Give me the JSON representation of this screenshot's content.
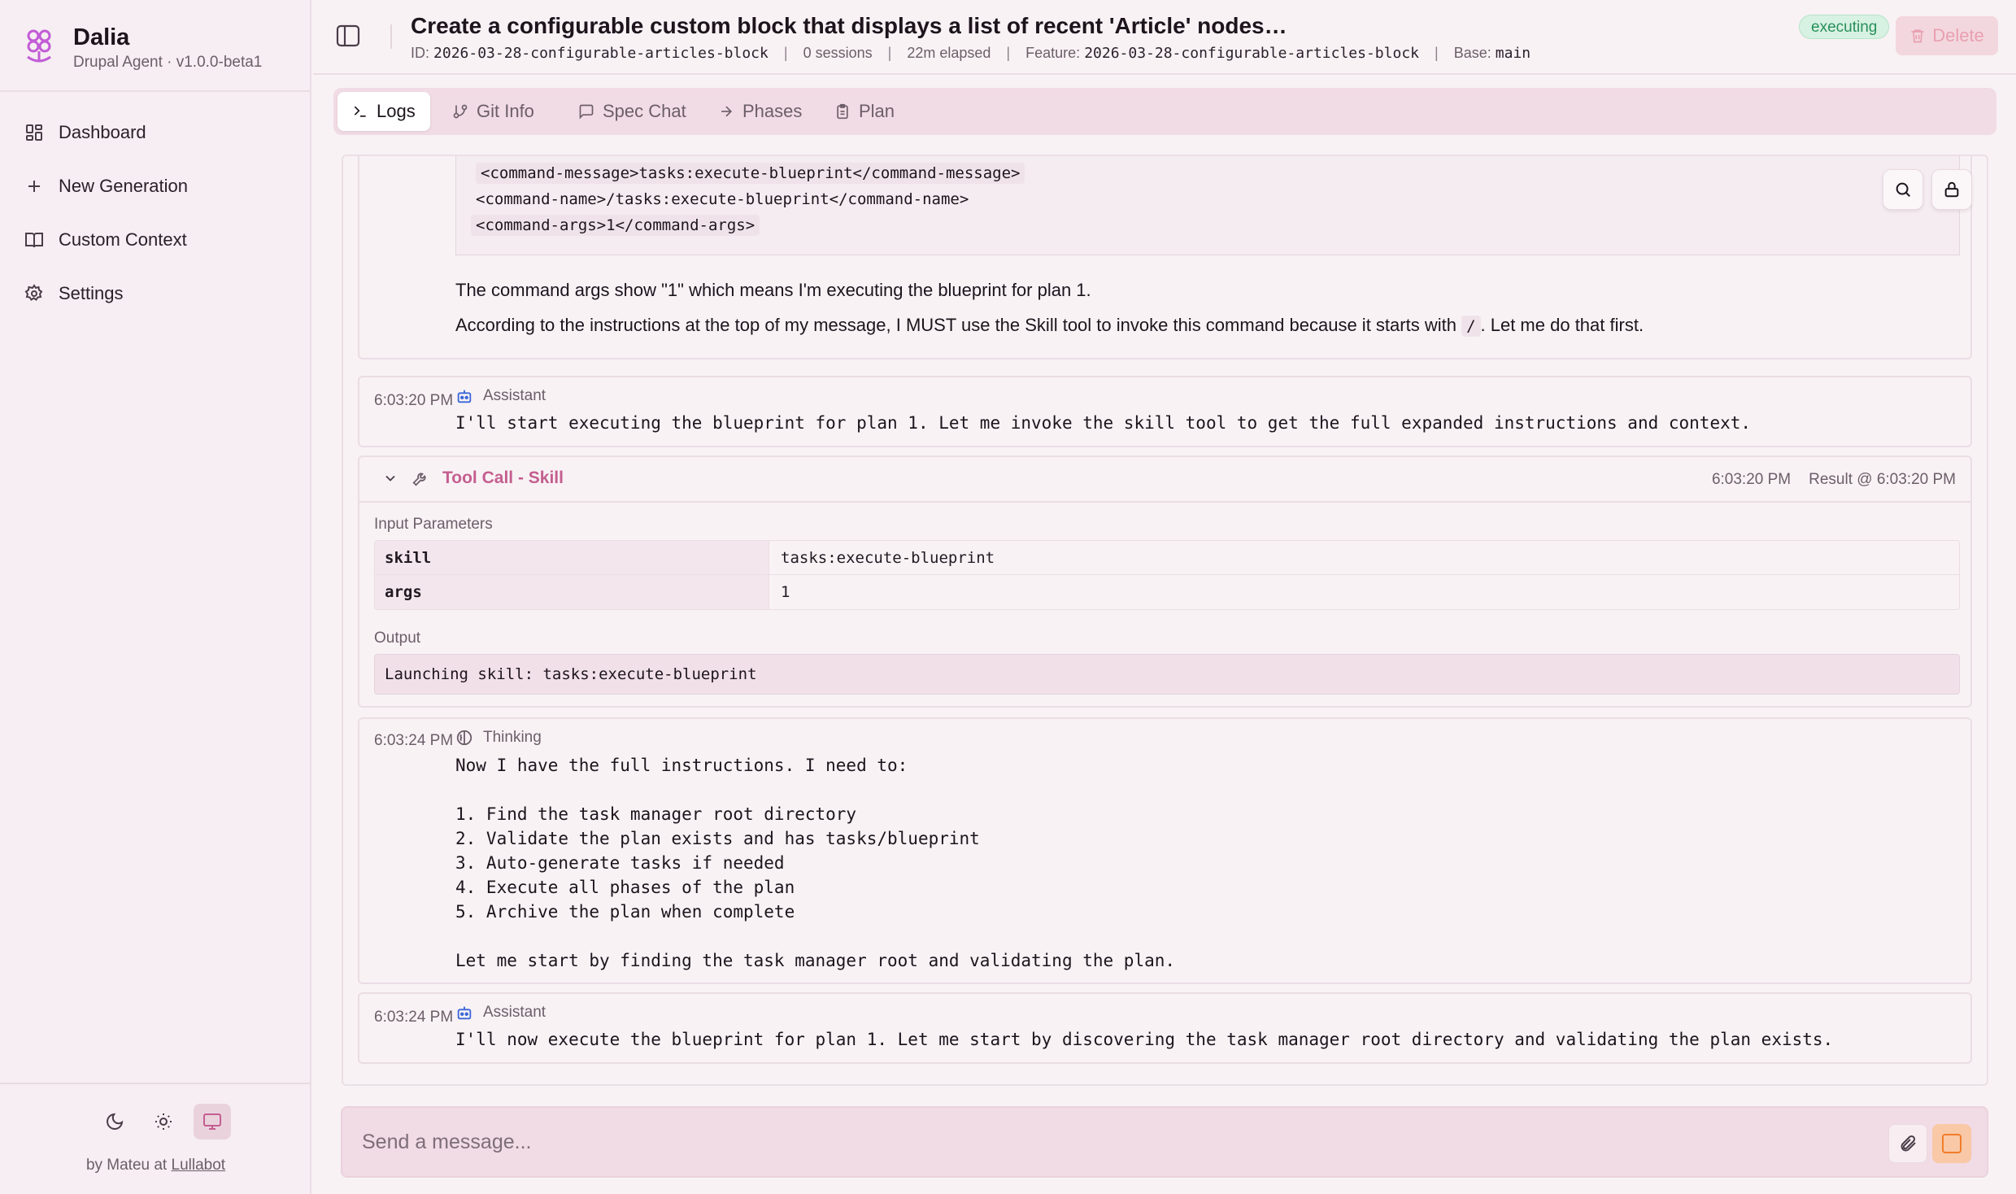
{
  "app": {
    "name": "Dalia",
    "subtitle": "Drupal Agent · v1.0.0-beta1",
    "credit_prefix": "by Mateu at",
    "credit_link": "Lullabot"
  },
  "sidebar": {
    "items": [
      {
        "label": "Dashboard",
        "icon": "dashboard-icon"
      },
      {
        "label": "New Generation",
        "icon": "plus-icon"
      },
      {
        "label": "Custom Context",
        "icon": "book-icon"
      },
      {
        "label": "Settings",
        "icon": "gear-icon"
      }
    ],
    "theme_options": [
      "dark",
      "light",
      "system"
    ],
    "theme_selected": "system"
  },
  "header": {
    "title": "Create a configurable custom block that displays a list of recent 'Article' nodes. Use dependency injection for the EntityType...",
    "status": "executing",
    "delete_label": "Delete",
    "meta": {
      "id_label": "ID:",
      "id_value": "2026-03-28-configurable-articles-block",
      "sessions": "0 sessions",
      "elapsed": "22m elapsed",
      "feature_label": "Feature:",
      "feature_value": "2026-03-28-configurable-articles-block",
      "base_label": "Base:",
      "base_value": "main"
    }
  },
  "tabs": [
    {
      "label": "Logs",
      "icon": "terminal-icon",
      "active": true
    },
    {
      "label": "Git Info",
      "icon": "git-branch-icon",
      "active": false
    },
    {
      "label": "Spec Chat",
      "icon": "chat-icon",
      "active": false
    },
    {
      "label": "Phases",
      "icon": "arrow-right-icon",
      "active": false
    },
    {
      "label": "Plan",
      "icon": "clipboard-icon",
      "active": false
    }
  ],
  "log": {
    "entry1": {
      "code_lines": [
        "<command-message>tasks:execute-blueprint</command-message>",
        "<command-name>/tasks:execute-blueprint</command-name>",
        "<command-args>1</command-args>"
      ],
      "para1": "The command args show \"1\" which means I'm executing the blueprint for plan 1.",
      "para2_before": "According to the instructions at the top of my message, I MUST use the Skill tool to invoke this command because it starts with",
      "para2_code": "/",
      "para2_after": ". Let me do that first."
    },
    "entry2": {
      "time": "6:03:20 PM",
      "role": "Assistant",
      "text": "I'll start executing the blueprint for plan 1. Let me invoke the skill tool to get the full expanded instructions and context."
    },
    "tool_call": {
      "title": "Tool Call - Skill",
      "time": "6:03:20 PM",
      "result": "Result @ 6:03:20 PM",
      "input_label": "Input Parameters",
      "params": [
        {
          "key": "skill",
          "value": "tasks:execute-blueprint"
        },
        {
          "key": "args",
          "value": "1"
        }
      ],
      "output_label": "Output",
      "output": "Launching skill: tasks:execute-blueprint"
    },
    "entry3": {
      "time": "6:03:24 PM",
      "role": "Thinking",
      "text": "Now I have the full instructions. I need to:\n\n1. Find the task manager root directory\n2. Validate the plan exists and has tasks/blueprint\n3. Auto-generate tasks if needed\n4. Execute all phases of the plan\n5. Archive the plan when complete\n\nLet me start by finding the task manager root and validating the plan."
    },
    "entry4": {
      "time": "6:03:24 PM",
      "role": "Assistant",
      "text": "I'll now execute the blueprint for plan 1. Let me start by discovering the task manager root directory and validating the plan exists."
    }
  },
  "composer": {
    "placeholder": "Send a message..."
  },
  "colors": {
    "accent": "#c45e8f",
    "status_bg": "#d7f1e2",
    "status_fg": "#28905a",
    "stop": "#f07d2a"
  }
}
